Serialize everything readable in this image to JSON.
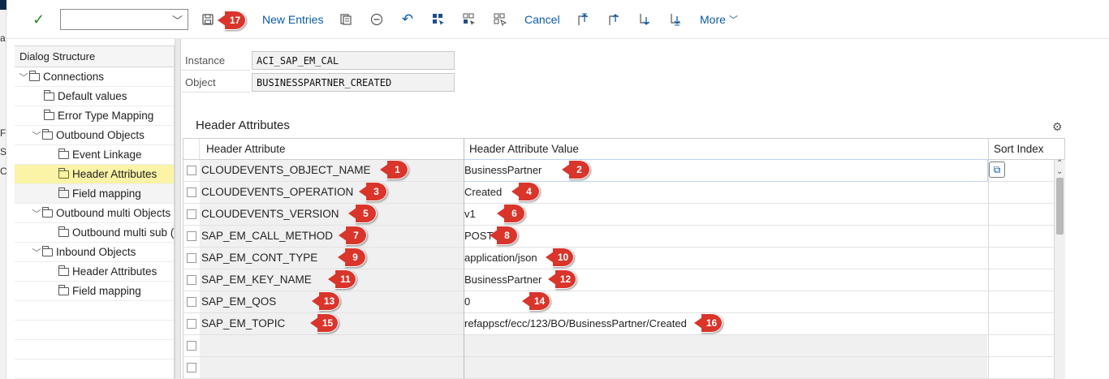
{
  "toolbar": {
    "command_value": "",
    "new_entries_label": "New Entries",
    "cancel_label": "Cancel",
    "more_label": "More"
  },
  "left_strip": {
    "letters": [
      "a",
      "F",
      "S",
      "C"
    ]
  },
  "dialog_structure": {
    "header": "Dialog Structure",
    "items": [
      {
        "label": "Connections"
      },
      {
        "label": "Default values"
      },
      {
        "label": "Error Type Mapping"
      },
      {
        "label": "Outbound  Objects"
      },
      {
        "label": "Event Linkage"
      },
      {
        "label": "Header Attributes"
      },
      {
        "label": "Field mapping"
      },
      {
        "label": "Outbound multi Objects"
      },
      {
        "label": "Outbound multi sub ("
      },
      {
        "label": "Inbound Objects"
      },
      {
        "label": "Header Attributes"
      },
      {
        "label": "Field mapping"
      }
    ]
  },
  "fields": {
    "instance_label": "Instance",
    "instance_value": "ACI_SAP_EM_CAL",
    "object_label": "Object",
    "object_value": "BUSINESSPARTNER_CREATED"
  },
  "section_title": "Header Attributes",
  "table": {
    "columns": [
      "Header Attribute",
      "Header Attribute Value",
      "Sort Index"
    ],
    "rows": [
      {
        "attr": "CLOUDEVENTS_OBJECT_NAME",
        "value": "BusinessPartner",
        "b1": "1",
        "b2": "2"
      },
      {
        "attr": "CLOUDEVENTS_OPERATION",
        "value": "Created",
        "b1": "3",
        "b2": "4"
      },
      {
        "attr": "CLOUDEVENTS_VERSION",
        "value": "v1",
        "b1": "5",
        "b2": "6"
      },
      {
        "attr": "SAP_EM_CALL_METHOD",
        "value": "POST",
        "b1": "7",
        "b2": "8"
      },
      {
        "attr": "SAP_EM_CONT_TYPE",
        "value": "application/json",
        "b1": "9",
        "b2": "10"
      },
      {
        "attr": "SAP_EM_KEY_NAME",
        "value": "BusinessPartner",
        "b1": "11",
        "b2": "12"
      },
      {
        "attr": "SAP_EM_QOS",
        "value": "0",
        "b1": "13",
        "b2": "14"
      },
      {
        "attr": "SAP_EM_TOPIC",
        "value": "refappscf/ecc/123/BO/BusinessPartner/Created",
        "b1": "15",
        "b2": "16"
      }
    ]
  },
  "save_badge": "17"
}
